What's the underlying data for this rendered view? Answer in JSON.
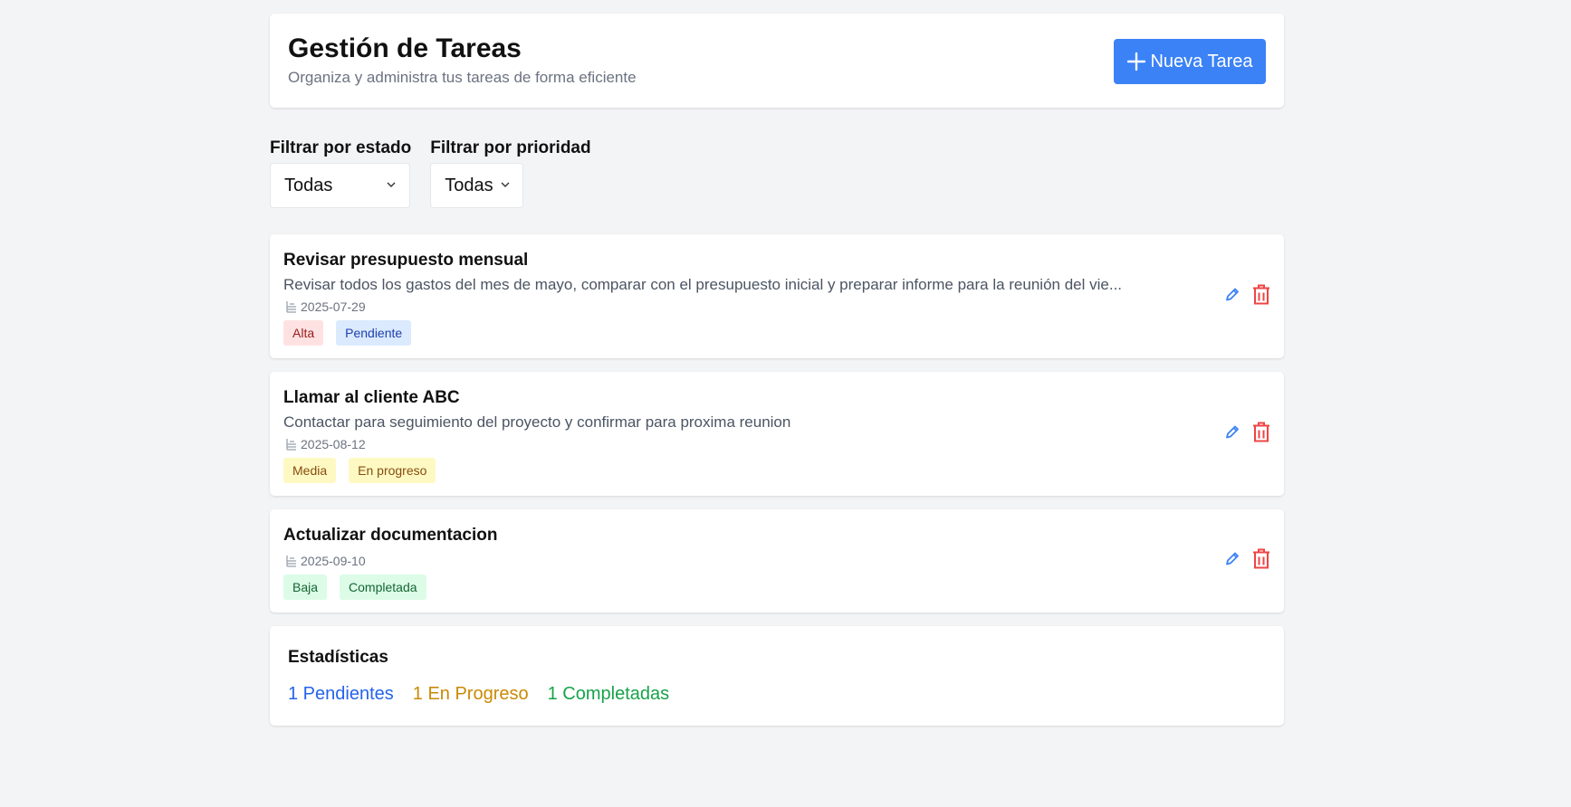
{
  "header": {
    "title": "Gestión de Tareas",
    "subtitle": "Organiza y administra tus tareas de forma eficiente",
    "new_task_label": "Nueva Tarea"
  },
  "filters": {
    "estado_label": "Filtrar por estado",
    "estado_value": "Todas",
    "prioridad_label": "Filtrar por prioridad",
    "prioridad_value": "Todas"
  },
  "tasks": [
    {
      "title": "Revisar presupuesto mensual",
      "description": "Revisar todos los gastos del mes de mayo, comparar con el presupuesto inicial y preparar informe para la reunión del vie...",
      "date": "2025-07-29",
      "priority": "Alta",
      "status": "Pendiente"
    },
    {
      "title": "Llamar al cliente ABC",
      "description": "Contactar para seguimiento del proyecto y confirmar para proxima reunion",
      "date": "2025-08-12",
      "priority": "Media",
      "status": "En progreso"
    },
    {
      "title": "Actualizar documentacion",
      "description": "",
      "date": "2025-09-10",
      "priority": "Baja",
      "status": "Completada"
    }
  ],
  "stats": {
    "title": "Estadísticas",
    "pendientes": "1 Pendientes",
    "en_progreso": "1 En Progreso",
    "completadas": "1 Completadas"
  },
  "icons": {
    "plus": "plus-icon",
    "calendar": "calendar-icon",
    "edit": "pencil-icon",
    "delete": "trash-icon",
    "dropdown": "chevron-down-icon"
  },
  "colors": {
    "primary": "#3b82f6",
    "edit": "#3b82f6",
    "delete": "#ef4444",
    "stat_pending": "#2563eb",
    "stat_progress": "#ca8a04",
    "stat_completed": "#16a34a"
  }
}
